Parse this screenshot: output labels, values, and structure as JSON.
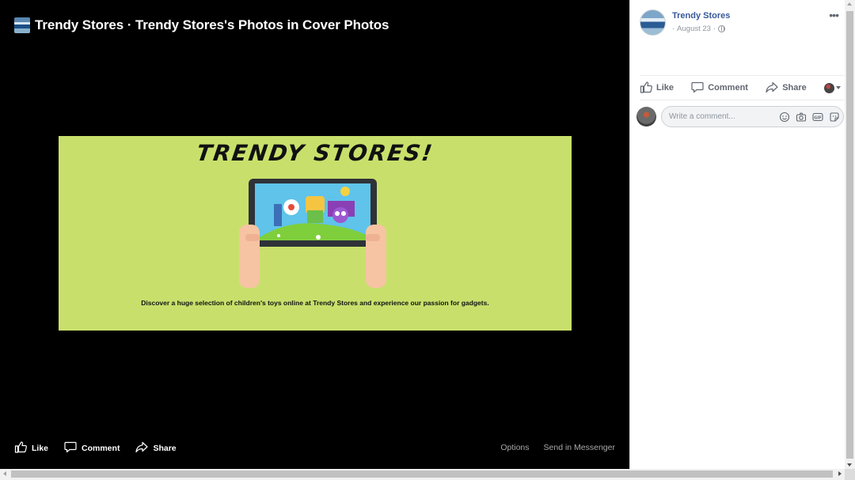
{
  "viewer": {
    "title": "Trendy Stores · Trendy Stores's Photos in Cover Photos",
    "photo": {
      "headline": "TRENDY STORES!",
      "caption": "Discover a huge selection of children's toys online at Trendy Stores and experience our passion for gadgets.",
      "background_color": "#c8e06b"
    },
    "actions": {
      "like": "Like",
      "comment": "Comment",
      "share": "Share"
    },
    "links": {
      "options": "Options",
      "send_in_messenger": "Send in Messenger"
    }
  },
  "panel": {
    "page_name": "Trendy Stores",
    "date": "August 23",
    "separator": "·",
    "actions": {
      "like": "Like",
      "comment": "Comment",
      "share": "Share"
    },
    "comment_input": {
      "placeholder": "Write a comment..."
    },
    "icons": [
      "more-icon",
      "globe-icon",
      "like-icon",
      "comment-icon",
      "share-icon",
      "emoji-icon",
      "camera-icon",
      "gif-icon",
      "sticker-icon"
    ]
  },
  "colors": {
    "viewer_bg": "#000000",
    "link_blue": "#385898",
    "meta_gray": "#90949c"
  }
}
